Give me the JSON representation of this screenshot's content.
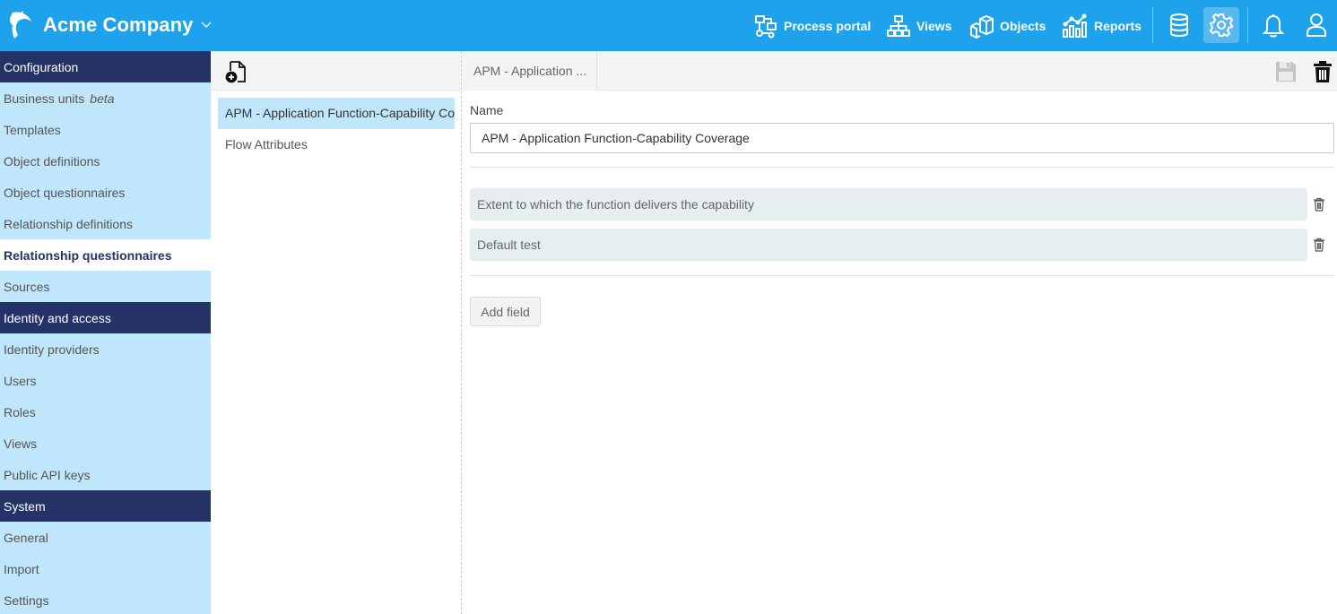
{
  "header": {
    "company": "Acme Company",
    "nav": [
      {
        "label": "Process portal",
        "icon": "process-icon"
      },
      {
        "label": "Views",
        "icon": "hierarchy-icon"
      },
      {
        "label": "Objects",
        "icon": "cubes-icon"
      },
      {
        "label": "Reports",
        "icon": "chart-icon"
      }
    ],
    "icons": [
      "database-icon",
      "gear-icon",
      "bell-icon",
      "user-icon"
    ],
    "colors": {
      "bar": "#1fa2ec",
      "active": "#5ab8f0"
    }
  },
  "sidebar": {
    "sections": [
      {
        "title": "Configuration",
        "items": [
          {
            "label": "Business units",
            "tag": "beta"
          },
          {
            "label": "Templates"
          },
          {
            "label": "Object definitions"
          },
          {
            "label": "Object questionnaires"
          },
          {
            "label": "Relationship definitions"
          },
          {
            "label": "Relationship questionnaires",
            "active": true
          },
          {
            "label": "Sources"
          }
        ]
      },
      {
        "title": "Identity and access",
        "items": [
          {
            "label": "Identity providers"
          },
          {
            "label": "Users"
          },
          {
            "label": "Roles"
          },
          {
            "label": "Views"
          },
          {
            "label": "Public API keys"
          }
        ]
      },
      {
        "title": "System",
        "items": [
          {
            "label": "General"
          },
          {
            "label": "Import"
          },
          {
            "label": "Settings"
          }
        ]
      }
    ]
  },
  "list": {
    "items": [
      {
        "label": "APM - Application Function-Capability Coverage",
        "selected": true
      },
      {
        "label": "Flow Attributes"
      }
    ]
  },
  "detail": {
    "tab_label": "APM - Application ...",
    "name_label": "Name",
    "name_value": "APM - Application Function-Capability Coverage",
    "fields": [
      "Extent to which the function delivers the capability",
      "Default test"
    ],
    "add_field_label": "Add field"
  }
}
